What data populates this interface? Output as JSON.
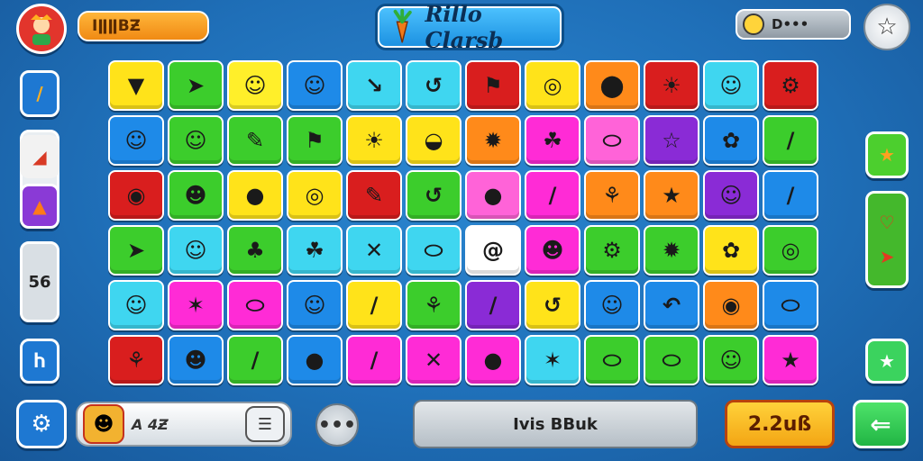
{
  "header": {
    "score_label": "IǁǁBƵ",
    "title": "Rillo Clarsb",
    "coin_label": "D•••"
  },
  "left_rail": {
    "counter_label": "56"
  },
  "bottom": {
    "player_name": "A 4Ƶ",
    "more_label": "•••",
    "action_label": "Ivis BBuk",
    "price_label": "2.2uß"
  },
  "colors": {
    "background": "#1f6fb8",
    "accent_orange": "#f08a14",
    "accent_green": "#21b544"
  },
  "grid": {
    "rows": 6,
    "cols": 12,
    "tiles": [
      {
        "color": "#ffe31a",
        "icon": "fox-face",
        "glyph": "▼"
      },
      {
        "color": "#3ccd2c",
        "icon": "arrow-cursor",
        "glyph": "➤"
      },
      {
        "color": "#ffef2a",
        "icon": "smiley",
        "glyph": "☺"
      },
      {
        "color": "#1e8ae8",
        "icon": "smiley",
        "glyph": "☺"
      },
      {
        "color": "#3fd6f0",
        "icon": "feather",
        "glyph": "↘"
      },
      {
        "color": "#3fd6f0",
        "icon": "hook",
        "glyph": "↺"
      },
      {
        "color": "#d91e1e",
        "icon": "flag",
        "glyph": "⚑"
      },
      {
        "color": "#ffe31a",
        "icon": "coin",
        "glyph": "◎"
      },
      {
        "color": "#ff8a1a",
        "icon": "rocket",
        "glyph": "⬤"
      },
      {
        "color": "#d91e1e",
        "icon": "sun",
        "glyph": "☀"
      },
      {
        "color": "#3fd6f0",
        "icon": "smiley",
        "glyph": "☺"
      },
      {
        "color": "#d91e1e",
        "icon": "gear",
        "glyph": "⚙"
      },
      {
        "color": "#1e8ae8",
        "icon": "smiley",
        "glyph": "☺"
      },
      {
        "color": "#3ccd2c",
        "icon": "smiley",
        "glyph": "☺"
      },
      {
        "color": "#3ccd2c",
        "icon": "pencil",
        "glyph": "✎"
      },
      {
        "color": "#3ccd2c",
        "icon": "flag",
        "glyph": "⚑"
      },
      {
        "color": "#ffe31a",
        "icon": "sun",
        "glyph": "☀"
      },
      {
        "color": "#ffe31a",
        "icon": "owl",
        "glyph": "◒"
      },
      {
        "color": "#ff8a1a",
        "icon": "splat",
        "glyph": "✹"
      },
      {
        "color": "#ff2bd6",
        "icon": "leaf",
        "glyph": "☘"
      },
      {
        "color": "#ff63d8",
        "icon": "football",
        "glyph": "⬭"
      },
      {
        "color": "#8a2bd6",
        "icon": "star-outline",
        "glyph": "☆"
      },
      {
        "color": "#1e8ae8",
        "icon": "flower",
        "glyph": "✿"
      },
      {
        "color": "#3ccd2c",
        "icon": "feather",
        "glyph": "∕"
      },
      {
        "color": "#d91e1e",
        "icon": "target",
        "glyph": "◉"
      },
      {
        "color": "#3ccd2c",
        "icon": "face",
        "glyph": "☻"
      },
      {
        "color": "#ffe31a",
        "icon": "cherry",
        "glyph": "●"
      },
      {
        "color": "#ffe31a",
        "icon": "donut",
        "glyph": "◎"
      },
      {
        "color": "#d91e1e",
        "icon": "pencil",
        "glyph": "✎"
      },
      {
        "color": "#3ccd2c",
        "icon": "hook",
        "glyph": "↺"
      },
      {
        "color": "#ff63d8",
        "icon": "apple",
        "glyph": "●"
      },
      {
        "color": "#ff2bd6",
        "icon": "crayon",
        "glyph": "∕"
      },
      {
        "color": "#ff8a1a",
        "icon": "leaf",
        "glyph": "⚘"
      },
      {
        "color": "#ff8a1a",
        "icon": "star",
        "glyph": "★"
      },
      {
        "color": "#8a2bd6",
        "icon": "smiley",
        "glyph": "☺"
      },
      {
        "color": "#1e8ae8",
        "icon": "crayon",
        "glyph": "∕"
      },
      {
        "color": "#3ccd2c",
        "icon": "arrow-cursor",
        "glyph": "➤"
      },
      {
        "color": "#3fd6f0",
        "icon": "cat-face",
        "glyph": "☺"
      },
      {
        "color": "#3ccd2c",
        "icon": "stamp",
        "glyph": "♣"
      },
      {
        "color": "#3fd6f0",
        "icon": "leaf",
        "glyph": "☘"
      },
      {
        "color": "#3fd6f0",
        "icon": "arrow-cross",
        "glyph": "✕"
      },
      {
        "color": "#3fd6f0",
        "icon": "football",
        "glyph": "⬭"
      },
      {
        "color": "#ffffff",
        "icon": "at-sign",
        "glyph": "@"
      },
      {
        "color": "#ff2bd6",
        "icon": "frog",
        "glyph": "☻"
      },
      {
        "color": "#3ccd2c",
        "icon": "gear",
        "glyph": "⚙"
      },
      {
        "color": "#3ccd2c",
        "icon": "splat",
        "glyph": "✹"
      },
      {
        "color": "#ffe31a",
        "icon": "flower",
        "glyph": "✿"
      },
      {
        "color": "#3ccd2c",
        "icon": "spiral",
        "glyph": "◎"
      },
      {
        "color": "#3fd6f0",
        "icon": "cat-face",
        "glyph": "☺"
      },
      {
        "color": "#ff2bd6",
        "icon": "star-burst",
        "glyph": "✶"
      },
      {
        "color": "#ff2bd6",
        "icon": "football",
        "glyph": "⬭"
      },
      {
        "color": "#1e8ae8",
        "icon": "ghost",
        "glyph": "☺"
      },
      {
        "color": "#ffe31a",
        "icon": "crayon",
        "glyph": "∕"
      },
      {
        "color": "#3ccd2c",
        "icon": "leaf",
        "glyph": "⚘"
      },
      {
        "color": "#8a2bd6",
        "icon": "feather",
        "glyph": "∕"
      },
      {
        "color": "#ffe31a",
        "icon": "hook",
        "glyph": "↺"
      },
      {
        "color": "#1e8ae8",
        "icon": "smiley",
        "glyph": "☺"
      },
      {
        "color": "#1e8ae8",
        "icon": "hook",
        "glyph": "↶"
      },
      {
        "color": "#ff8a1a",
        "icon": "bird",
        "glyph": "◉"
      },
      {
        "color": "#1e8ae8",
        "icon": "leaf",
        "glyph": "⬭"
      },
      {
        "color": "#d91e1e",
        "icon": "leaf",
        "glyph": "⚘"
      },
      {
        "color": "#1e8ae8",
        "icon": "face",
        "glyph": "☻"
      },
      {
        "color": "#3ccd2c",
        "icon": "crayon",
        "glyph": "∕"
      },
      {
        "color": "#1e8ae8",
        "icon": "ball",
        "glyph": "●"
      },
      {
        "color": "#ff2bd6",
        "icon": "crayon",
        "glyph": "∕"
      },
      {
        "color": "#ff2bd6",
        "icon": "arrow-cross",
        "glyph": "✕"
      },
      {
        "color": "#ff2bd6",
        "icon": "orange",
        "glyph": "●"
      },
      {
        "color": "#3fd6f0",
        "icon": "star-burst",
        "glyph": "✶"
      },
      {
        "color": "#3ccd2c",
        "icon": "football",
        "glyph": "⬭"
      },
      {
        "color": "#3ccd2c",
        "icon": "football",
        "glyph": "⬭"
      },
      {
        "color": "#3ccd2c",
        "icon": "smiley",
        "glyph": "☺"
      },
      {
        "color": "#ff2bd6",
        "icon": "star",
        "glyph": "★"
      }
    ]
  }
}
